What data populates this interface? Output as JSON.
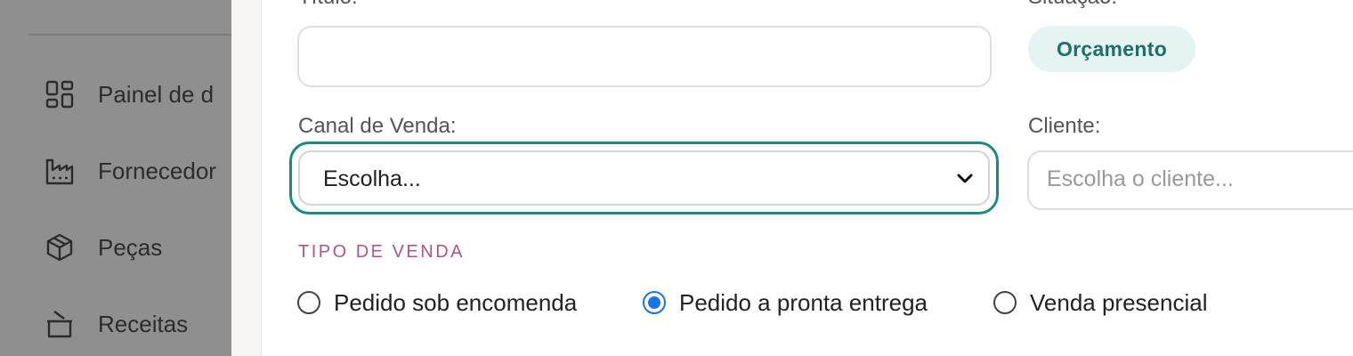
{
  "sidebar": {
    "items": [
      {
        "label": "Painel de d",
        "icon": "dashboard-icon"
      },
      {
        "label": "Fornecedor",
        "icon": "factory-icon"
      },
      {
        "label": "Peças",
        "icon": "box-icon"
      },
      {
        "label": "Receitas",
        "icon": "bowl-icon"
      }
    ]
  },
  "form": {
    "titulo_label": "Título:",
    "titulo_value": "",
    "situacao_label": "Situação:",
    "situacao_value": "Orçamento",
    "canal_label": "Canal de Venda:",
    "canal_value": "Escolha...",
    "cliente_label": "Cliente:",
    "cliente_placeholder": "Escolha o cliente...",
    "tipo_section": "TIPO DE VENDA",
    "tipo_options": [
      {
        "label": "Pedido sob encomenda",
        "checked": false
      },
      {
        "label": "Pedido a pronta entrega",
        "checked": true
      },
      {
        "label": "Venda presencial",
        "checked": false
      }
    ]
  },
  "colors": {
    "focus": "#1b8b82",
    "badge_bg": "#e5f3f2",
    "badge_text": "#1d6f69",
    "section": "#b1567e",
    "radio_checked": "#1a73e8"
  }
}
